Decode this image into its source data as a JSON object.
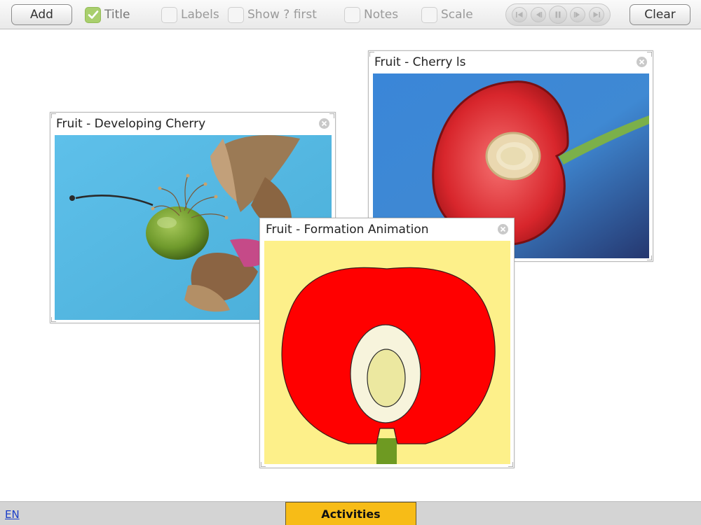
{
  "toolbar": {
    "add_label": "Add",
    "clear_label": "Clear",
    "options": [
      {
        "label": "Title",
        "checked": true
      },
      {
        "label": "Labels",
        "checked": false
      },
      {
        "label": "Show ? first",
        "checked": false
      },
      {
        "label": "Notes",
        "checked": false
      },
      {
        "label": "Scale",
        "checked": false
      }
    ],
    "media_controls": [
      "skip-to-start-icon",
      "step-back-icon",
      "pause-icon",
      "step-forward-icon",
      "skip-to-end-icon"
    ]
  },
  "panels": [
    {
      "title": "Fruit - Developing Cherry"
    },
    {
      "title": "Fruit - Cherry ls"
    },
    {
      "title": "Fruit - Formation Animation"
    }
  ],
  "footer": {
    "language": "EN",
    "activities_label": "Activities"
  },
  "colors": {
    "accent_check": "#a9cf6d",
    "activities": "#f7bc17",
    "photo_background": "#5bb8e2",
    "animation_background": "#fdf08a",
    "cherry_flesh": "#ff0000",
    "stone": "#f7f4dc",
    "seed": "#ece8a0",
    "stalk": "#6e9a22"
  }
}
